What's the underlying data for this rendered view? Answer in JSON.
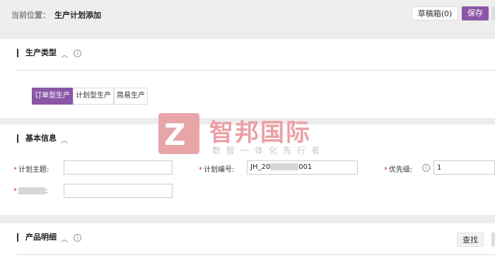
{
  "breadcrumb": {
    "prefix": "当前位置：",
    "current": "生产计划添加"
  },
  "toolbar": {
    "draft_label": "草稿箱(0)",
    "save_label": "保存"
  },
  "production_type": {
    "title": "生产类型",
    "tabs": [
      {
        "label": "订单型生产",
        "active": true
      },
      {
        "label": "计划型生产",
        "active": false
      },
      {
        "label": "简易生产",
        "active": false
      }
    ]
  },
  "basic_info": {
    "title": "基本信息",
    "fields": {
      "plan_subject": {
        "label": "计划主题:",
        "value": ""
      },
      "plan_number": {
        "label": "计划编号:",
        "value_prefix": "JH_20",
        "value_suffix": "001"
      },
      "priority": {
        "label": "优先级:",
        "value": "1"
      },
      "hidden_field": {
        "label_suffix": ":",
        "value": ""
      }
    }
  },
  "product_detail": {
    "title": "产品明细",
    "find_label": "查找"
  },
  "watermark": {
    "brand": "智邦国际",
    "slogan": "数智一体化先行者"
  },
  "colors": {
    "accent": "#8a57a6",
    "required": "#c0392b"
  }
}
